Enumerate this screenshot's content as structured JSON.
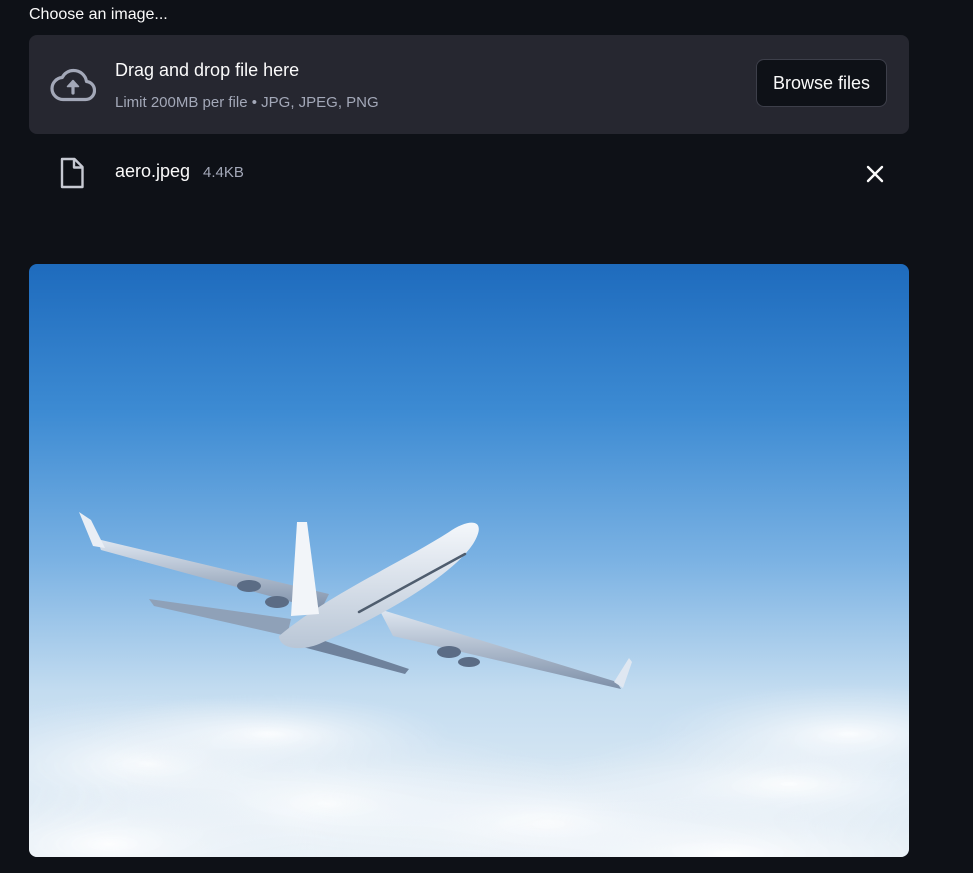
{
  "uploader": {
    "label": "Choose an image...",
    "dropzone": {
      "title": "Drag and drop file here",
      "subtitle": "Limit 200MB per file • JPG, JPEG, PNG",
      "icon": "cloud-upload-icon",
      "browse_label": "Browse files"
    },
    "file": {
      "icon": "file-icon",
      "name": "aero.jpeg",
      "size": "4.4KB",
      "remove_icon": "close-icon"
    }
  },
  "preview": {
    "subject": "airplane-above-clouds"
  },
  "colors": {
    "background": "#0e1117",
    "dropzone": "#262730",
    "text": "#fafafa",
    "muted_text": "#a3a8b8"
  }
}
